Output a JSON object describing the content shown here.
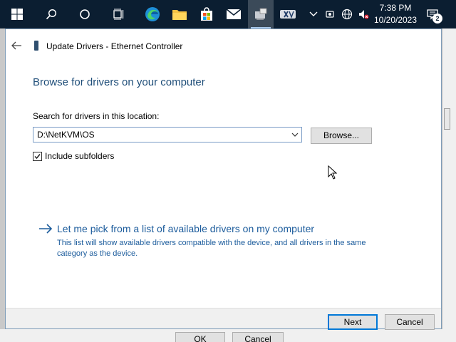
{
  "taskbar": {
    "clock_time": "7:38 PM",
    "clock_date": "10/20/2023",
    "notification_count": "2"
  },
  "dialog": {
    "title": "Update Drivers - Ethernet Controller",
    "heading": "Browse for drivers on your computer",
    "search_label": "Search for drivers in this location:",
    "path_value": "D:\\NetKVM\\OS",
    "browse_label": "Browse...",
    "include_subfolders_label": "Include subfolders",
    "include_subfolders_checked": true,
    "pick_link_label": "Let me pick from a list of available drivers on my computer",
    "pick_link_description": "This list will show available drivers compatible with the device, and all drivers in the same category as the device.",
    "next_label": "Next",
    "cancel_label": "Cancel"
  },
  "background_window": {
    "ok_label": "OK",
    "cancel_label": "Cancel"
  },
  "colors": {
    "taskbar": "#0b1e31",
    "heading": "#1f4e79",
    "link": "#1c5c9c",
    "accent": "#0078d7"
  }
}
